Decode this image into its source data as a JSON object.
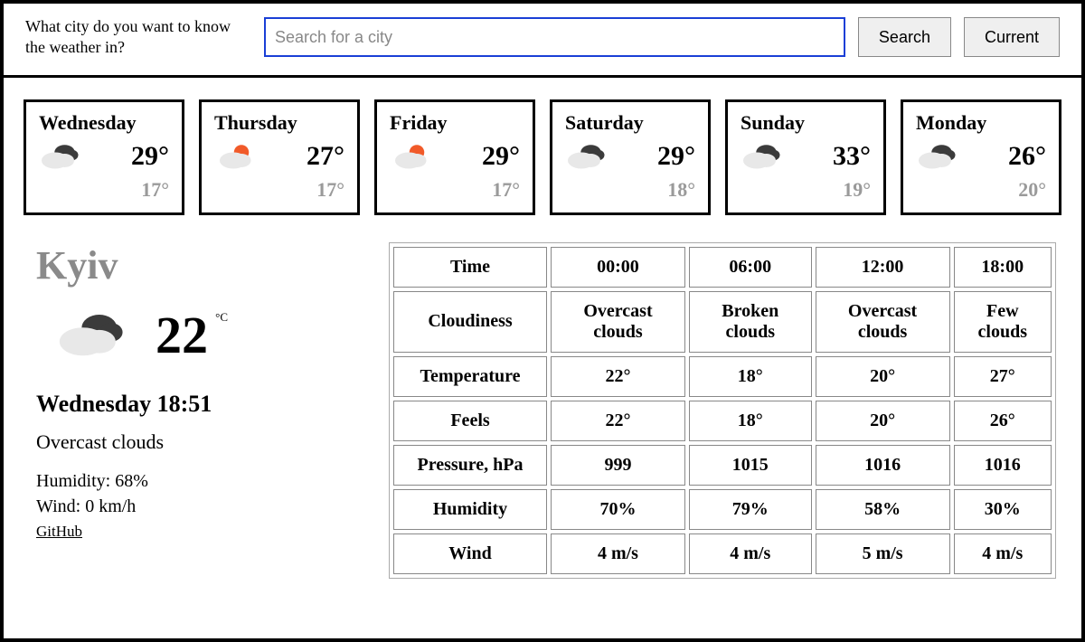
{
  "search": {
    "prompt": "What city do you want to know the weather in?",
    "placeholder": "Search for a city",
    "search_btn": "Search",
    "current_btn": "Current"
  },
  "forecast": [
    {
      "day": "Wednesday",
      "high": "29°",
      "low": "17°",
      "icon": "cloud-dark"
    },
    {
      "day": "Thursday",
      "high": "27°",
      "low": "17°",
      "icon": "cloud-sun"
    },
    {
      "day": "Friday",
      "high": "29°",
      "low": "17°",
      "icon": "cloud-sun"
    },
    {
      "day": "Saturday",
      "high": "29°",
      "low": "18°",
      "icon": "cloud-dark"
    },
    {
      "day": "Sunday",
      "high": "33°",
      "low": "19°",
      "icon": "cloud-dark"
    },
    {
      "day": "Monday",
      "high": "26°",
      "low": "20°",
      "icon": "cloud-dark"
    }
  ],
  "current": {
    "city": "Kyiv",
    "temp": "22",
    "unit": "°C",
    "icon": "cloud-dark",
    "datetime": "Wednesday 18:51",
    "condition": "Overcast clouds",
    "humidity_line": "Humidity: 68%",
    "wind_line": "Wind: 0 km/h",
    "github": "GitHub"
  },
  "hourly": {
    "rows": [
      {
        "label": "Time",
        "c": [
          "00:00",
          "06:00",
          "12:00",
          "18:00"
        ]
      },
      {
        "label": "Cloudiness",
        "c": [
          "Overcast clouds",
          "Broken clouds",
          "Overcast clouds",
          "Few clouds"
        ]
      },
      {
        "label": "Temperature",
        "c": [
          "22°",
          "18°",
          "20°",
          "27°"
        ]
      },
      {
        "label": "Feels",
        "c": [
          "22°",
          "18°",
          "20°",
          "26°"
        ]
      },
      {
        "label": "Pressure, hPa",
        "c": [
          "999",
          "1015",
          "1016",
          "1016"
        ]
      },
      {
        "label": "Humidity",
        "c": [
          "70%",
          "79%",
          "58%",
          "30%"
        ]
      },
      {
        "label": "Wind",
        "c": [
          "4 m/s",
          "4 m/s",
          "5 m/s",
          "4 m/s"
        ]
      }
    ]
  }
}
